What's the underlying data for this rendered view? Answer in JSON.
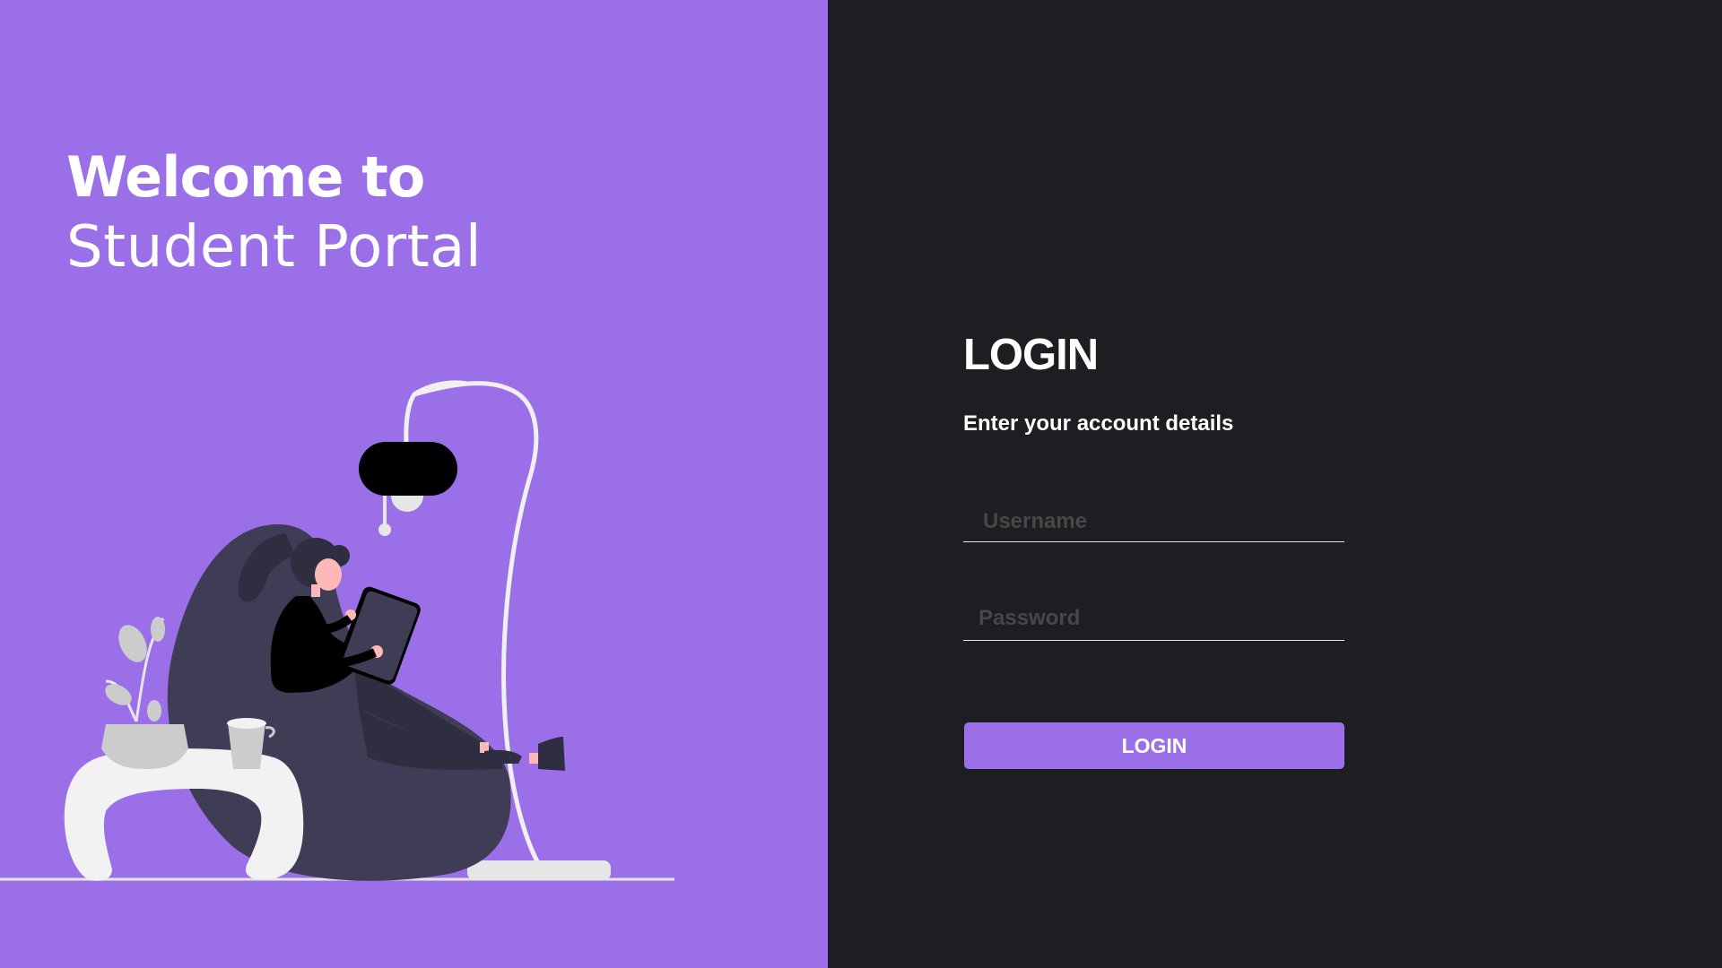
{
  "welcome": {
    "line1": "Welcome to",
    "line2": "Student Portal"
  },
  "login": {
    "title": "LOGIN",
    "subtitle": "Enter your account details",
    "username_placeholder": "Username",
    "username_value": "",
    "password_placeholder": "Password",
    "password_value": "",
    "button_label": "LOGIN"
  },
  "illustration": {
    "name": "woman-reading-tablet-illustration",
    "icons": [
      "floor-lamp",
      "bean-bag",
      "side-table",
      "plant-pot",
      "coffee-cup"
    ]
  },
  "colors": {
    "accent": "#9b6fe8",
    "panel_dark": "#1d1e21",
    "text_light": "#ffffff",
    "placeholder": "#4a4548"
  }
}
